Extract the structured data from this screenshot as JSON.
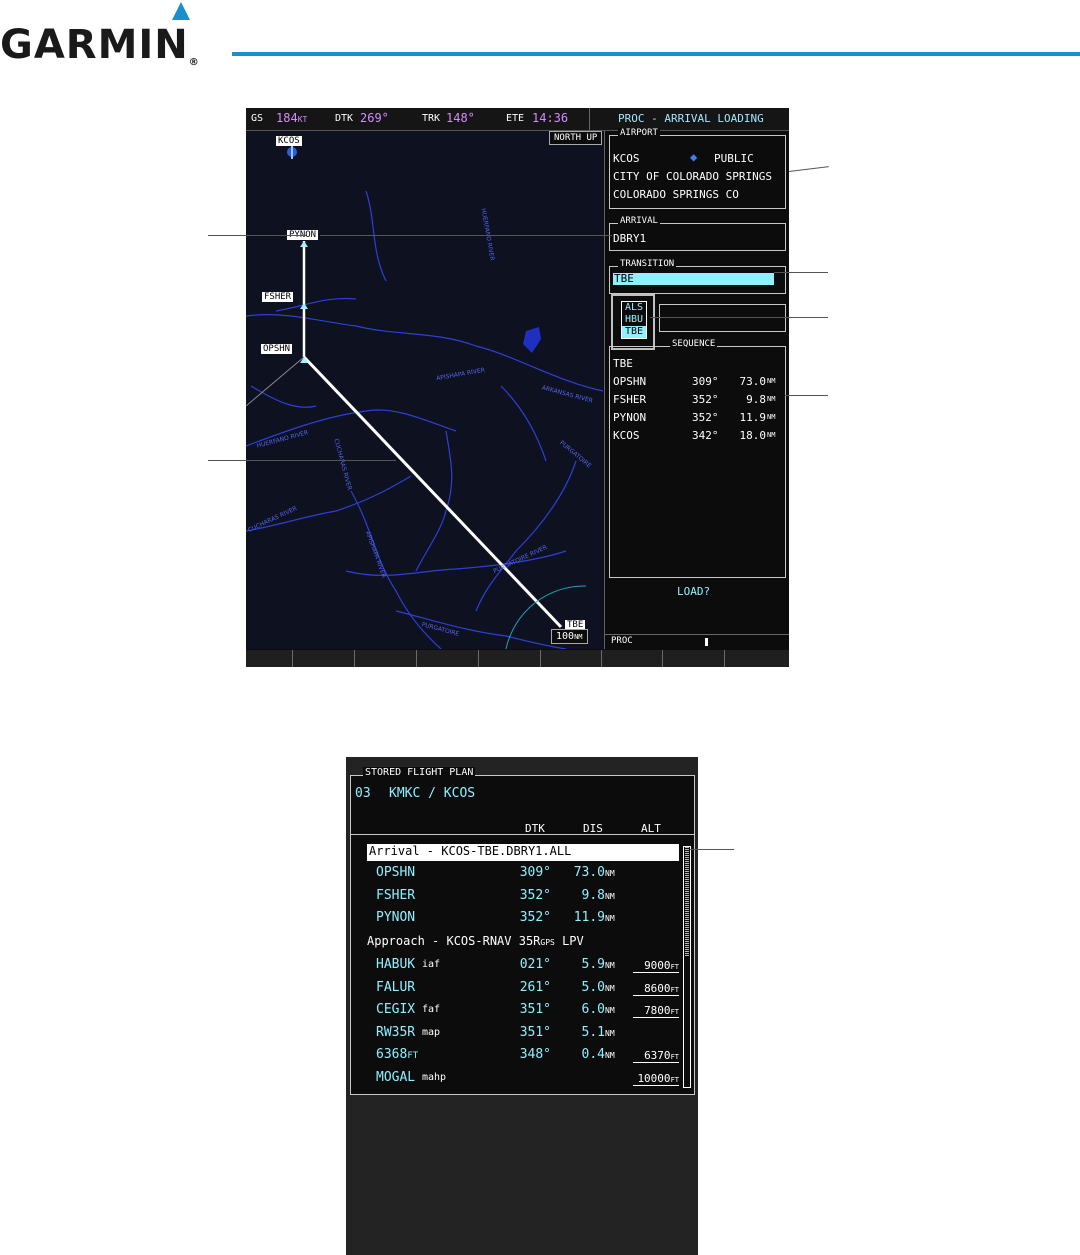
{
  "brand": {
    "name": "GARMIN",
    "registered": "®",
    "accent": "#1a8fcf"
  },
  "mfd": {
    "nav": {
      "gs_label": "GS",
      "gs_value": "184",
      "gs_unit": "KT",
      "dtk_label": "DTK",
      "dtk_value": "269°",
      "trk_label": "TRK",
      "trk_value": "148°",
      "ete_label": "ETE",
      "ete_value": "14:36",
      "page_title": "PROC - ARRIVAL LOADING"
    },
    "map": {
      "orientation": "NORTH UP",
      "range": "100",
      "range_unit": "NM",
      "waypoints": [
        "KCOS",
        "PYNON",
        "FSHER",
        "OPSHN",
        "TBE"
      ],
      "rivers": [
        "HUERFANO RIVER",
        "APISHAPA RIVER",
        "ARKANSAS RIVER",
        "HUERFANO RIVER",
        "CUCHARAS RIVER",
        "CUCHARAS RIVER",
        "PURGATOIRE",
        "APISHAPA RIVER",
        "PURGATOIRE RIVER",
        "PURGATOIRE"
      ]
    },
    "panel": {
      "airport_label": "AIRPORT",
      "airport_id": "KCOS",
      "airport_type": "PUBLIC",
      "airport_name": "CITY OF COLORADO SPRINGS",
      "airport_city": "COLORADO SPRINGS CO",
      "arrival_label": "ARRIVAL",
      "arrival_value": "DBRY1",
      "transition_label": "TRANSITION",
      "transition_value": "TBE",
      "transition_options": [
        "ALS",
        "HBU",
        "TBE"
      ],
      "sequence_label": "SEQUENCE",
      "sequence": [
        {
          "wpt": "TBE",
          "dtk": "",
          "dist": "",
          "unit": ""
        },
        {
          "wpt": "OPSHN",
          "dtk": "309°",
          "dist": "73.0",
          "unit": "NM"
        },
        {
          "wpt": "FSHER",
          "dtk": "352°",
          "dist": "9.8",
          "unit": "NM"
        },
        {
          "wpt": "PYNON",
          "dtk": "352°",
          "dist": "11.9",
          "unit": "NM"
        },
        {
          "wpt": "KCOS",
          "dtk": "342°",
          "dist": "18.0",
          "unit": "NM"
        }
      ],
      "load_prompt": "LOAD?",
      "status_label": "PROC"
    }
  },
  "flight_plan": {
    "title": "STORED FLIGHT PLAN",
    "plan_number": "03",
    "route": "KMKC / KCOS",
    "headers": {
      "dtk": "DTK",
      "dis": "DIS",
      "alt": "ALT"
    },
    "arrival_header": "Arrival - KCOS-TBE.DBRY1.ALL",
    "arrival_legs": [
      {
        "wpt": "OPSHN",
        "suffix": "",
        "dtk": "309°",
        "dis": "73.0",
        "unit": "NM",
        "alt": ""
      },
      {
        "wpt": "FSHER",
        "suffix": "",
        "dtk": "352°",
        "dis": "9.8",
        "unit": "NM",
        "alt": ""
      },
      {
        "wpt": "PYNON",
        "suffix": "",
        "dtk": "352°",
        "dis": "11.9",
        "unit": "NM",
        "alt": ""
      }
    ],
    "approach_header_a": "Approach - KCOS-RNAV 35R",
    "approach_header_gps": "GPS",
    "approach_header_b": " LPV",
    "approach_legs": [
      {
        "wpt": "HABUK",
        "suffix": "iaf",
        "dtk": "021°",
        "dis": "5.9",
        "unit": "NM",
        "alt": "9000",
        "alt_unit": "FT"
      },
      {
        "wpt": "FALUR",
        "suffix": "",
        "dtk": "261°",
        "dis": "5.0",
        "unit": "NM",
        "alt": "8600",
        "alt_unit": "FT"
      },
      {
        "wpt": "CEGIX",
        "suffix": "faf",
        "dtk": "351°",
        "dis": "6.0",
        "unit": "NM",
        "alt": "7800",
        "alt_unit": "FT"
      },
      {
        "wpt": "RW35R",
        "suffix": "map",
        "dtk": "351°",
        "dis": "5.1",
        "unit": "NM",
        "alt": "",
        "alt_unit": ""
      },
      {
        "wpt": "6368",
        "wpt_unit": "FT",
        "suffix": "",
        "dtk": "348°",
        "dis": "0.4",
        "unit": "NM",
        "alt": "6370",
        "alt_unit": "FT"
      },
      {
        "wpt": "MOGAL",
        "suffix": "mahp",
        "dtk": "",
        "dis": "",
        "unit": "",
        "alt": "10000",
        "alt_unit": "FT"
      }
    ]
  }
}
